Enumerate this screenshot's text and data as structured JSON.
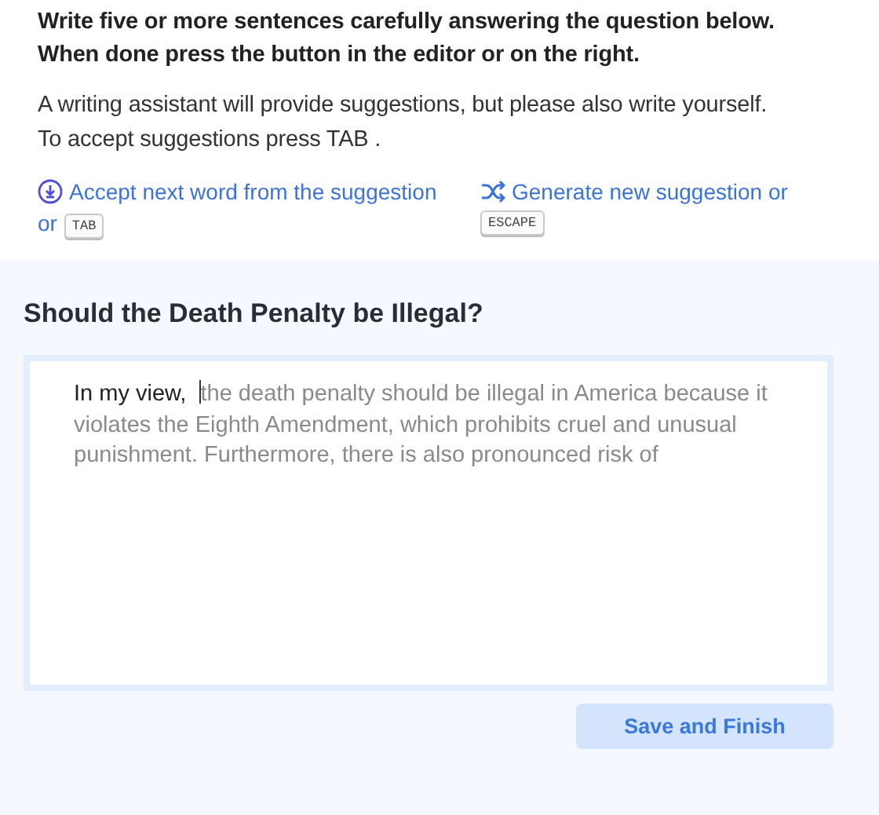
{
  "instructions": [
    "Write **five or more** sentences carefully answering the question below.",
    "When done **press the button in the editor or on the right.**"
  ],
  "notes": [
    "A writing assistant will provide suggestions, but please also write yourself.",
    "To accept suggestions press TAB ."
  ],
  "hints": [
    {
      "kind": "accept",
      "text": "Accept next word from the suggestion",
      "joiner": "or",
      "key": "TAB"
    },
    {
      "kind": "generate",
      "text": "Generate new suggestion or",
      "key": "ESCAPE"
    }
  ],
  "question": "Should the Death Penalty be Illegal?",
  "editor": {
    "typed": "In my view,",
    "suggestion": "the death penalty should be illegal in America because it violates the Eighth Amendment, which prohibits cruel and unusual punishment. Furthermore, there is also pronounced risk of"
  },
  "button": "Save and Finish"
}
